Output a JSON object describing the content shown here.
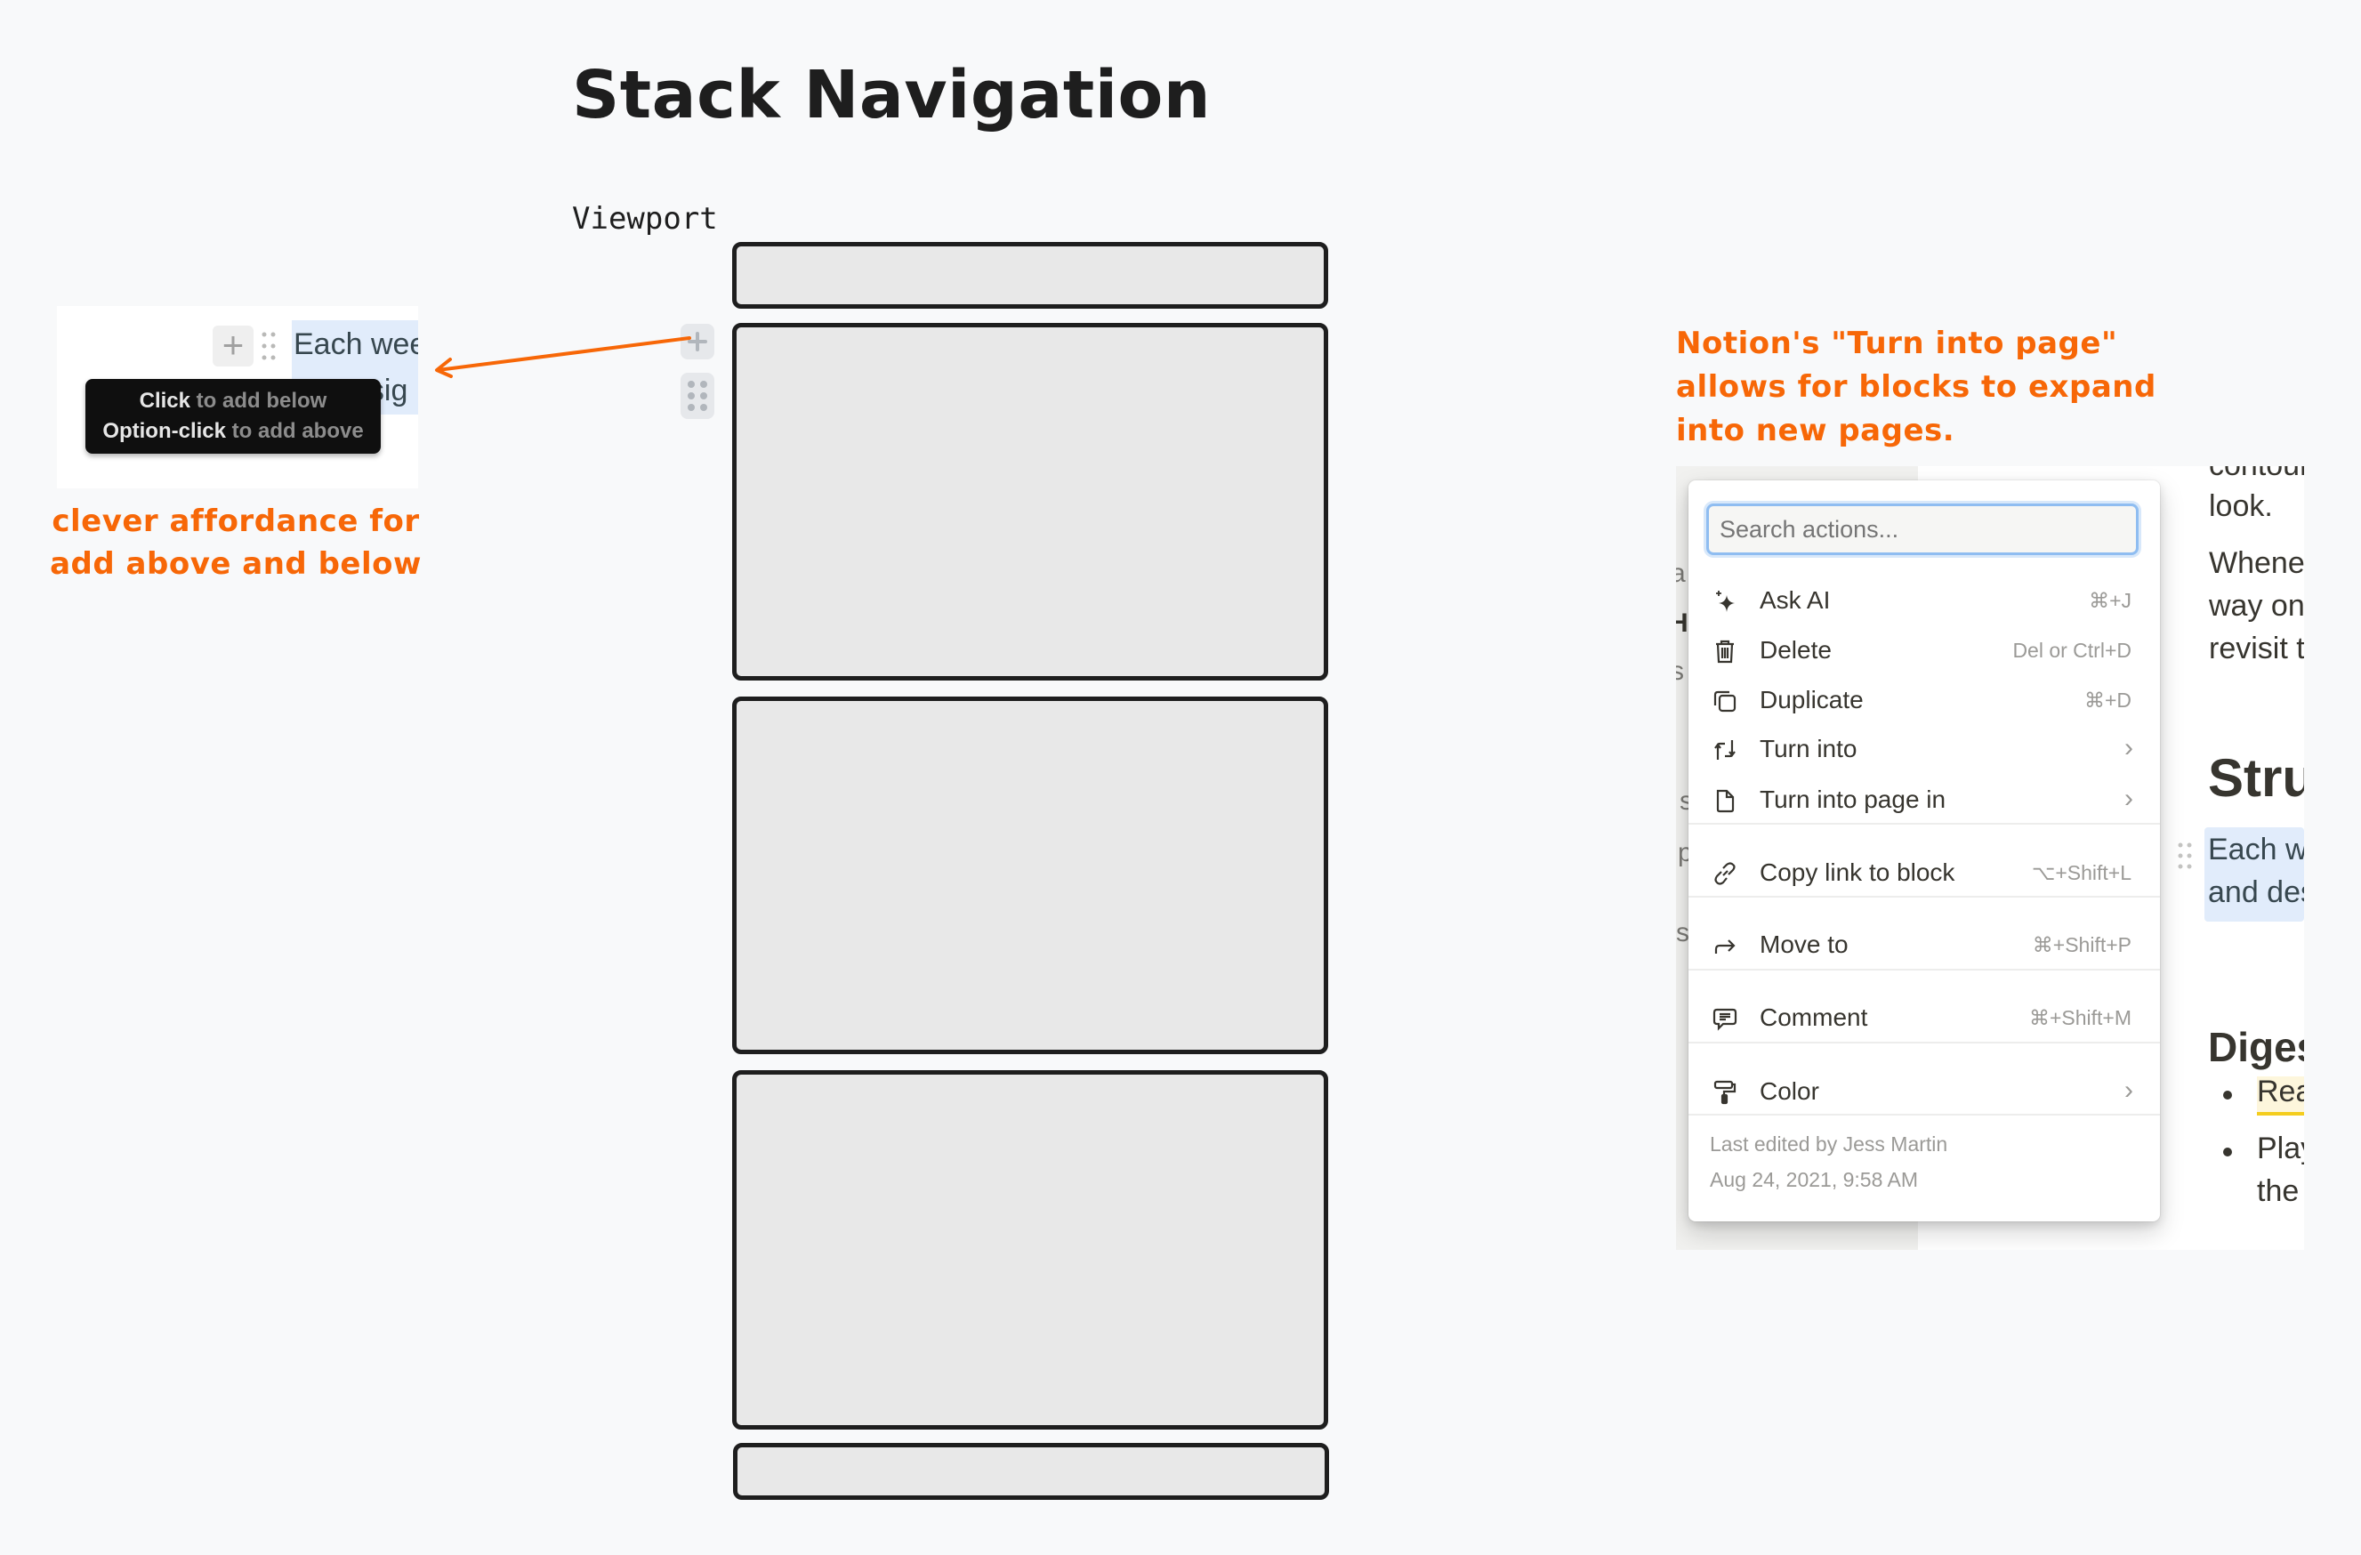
{
  "title": "Stack Navigation",
  "viewport_label": "Viewport",
  "colors": {
    "background": "#f8f9fa",
    "annotation": "#f76707",
    "stroke": "#1e1e1e",
    "box_fill": "#e8e8e8",
    "selection_highlight": "#e1ecfb",
    "search_focus": "#8fbdf1"
  },
  "stack": {
    "boxes": [
      {
        "name": "stack-box-top-partial"
      },
      {
        "name": "stack-box-1"
      },
      {
        "name": "stack-box-2"
      },
      {
        "name": "stack-box-3"
      },
      {
        "name": "stack-box-bottom-partial"
      }
    ],
    "add_icon": "plus-icon",
    "drag_icon": "drag-handle-icon"
  },
  "left_example": {
    "block_text_line1": "Each wee",
    "block_text_line2": "esig",
    "tooltip": {
      "line1_bold": "Click",
      "line1_rest": " to add below",
      "line2_bold": "Option-click",
      "line2_rest": " to add above"
    },
    "annotation_line1": "clever affordance for",
    "annotation_line2": "add above and below"
  },
  "right_example": {
    "annotation_line1": "Notion's \"Turn into page\"",
    "annotation_line2": "allows for blocks to expand",
    "annotation_line3": "into new pages.",
    "search_placeholder": "Search actions...",
    "menu_items": [
      {
        "icon": "sparkle-icon",
        "label": "Ask AI",
        "shortcut": "⌘+J"
      },
      {
        "icon": "trash-icon",
        "label": "Delete",
        "shortcut": "Del or Ctrl+D"
      },
      {
        "icon": "duplicate-icon",
        "label": "Duplicate",
        "shortcut": "⌘+D"
      },
      {
        "icon": "turn-into-icon",
        "label": "Turn into",
        "chevron": "›"
      },
      {
        "icon": "page-icon",
        "label": "Turn into page in",
        "chevron": "›"
      },
      {
        "icon": "link-icon",
        "label": "Copy link to block",
        "shortcut": "⌥+Shift+L"
      },
      {
        "icon": "move-arrow-icon",
        "label": "Move to",
        "shortcut": "⌘+Shift+P"
      },
      {
        "icon": "comment-icon",
        "label": "Comment",
        "shortcut": "⌘+Shift+M"
      },
      {
        "icon": "paint-roller-icon",
        "label": "Color",
        "chevron": "›"
      }
    ],
    "last_edited": "Last edited by Jess Martin",
    "last_edited_date": "Aug 24, 2021, 9:58 AM",
    "background_text": {
      "line_contour": "contour",
      "line_look": "look.",
      "line_whenev": "Whenev",
      "line_way": "way one",
      "line_revisit": "revisit t",
      "heading_stru": "Stru",
      "block_each": "Each we",
      "block_and": "and des",
      "heading_diges": "Diges",
      "bullet1": "Rea",
      "bullet2": "Play",
      "bullet2_cont": "the",
      "left_fragments": [
        "a",
        "Hi",
        "s",
        "s",
        "p",
        "s"
      ]
    }
  }
}
